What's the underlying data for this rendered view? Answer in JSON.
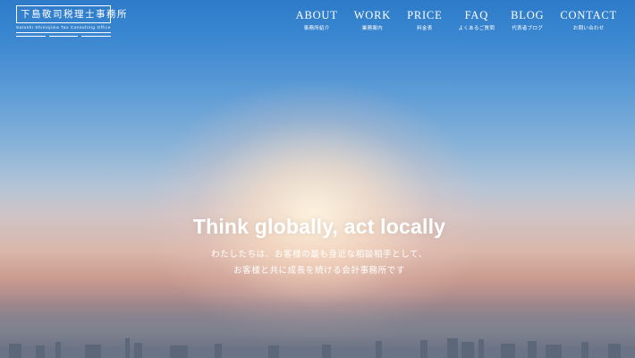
{
  "logo": {
    "title": "下島敬司税理士事務所",
    "subtitle": "Satoshi Shimojima Tax Consulting Office"
  },
  "nav": [
    {
      "label": "ABOUT",
      "sub": "事務所紹介"
    },
    {
      "label": "WORK",
      "sub": "業務案内"
    },
    {
      "label": "PRICE",
      "sub": "料金表"
    },
    {
      "label": "FAQ",
      "sub": "よくあるご質問"
    },
    {
      "label": "BLOG",
      "sub": "代表者ブログ"
    },
    {
      "label": "CONTACT",
      "sub": "お問い合わせ"
    }
  ],
  "hero": {
    "headline": "Think globally, act locally",
    "lines": [
      "わたしたちは、お客様の最も身近な相談相手として、",
      "お客様と共に成長を続ける会計事務所です"
    ]
  }
}
